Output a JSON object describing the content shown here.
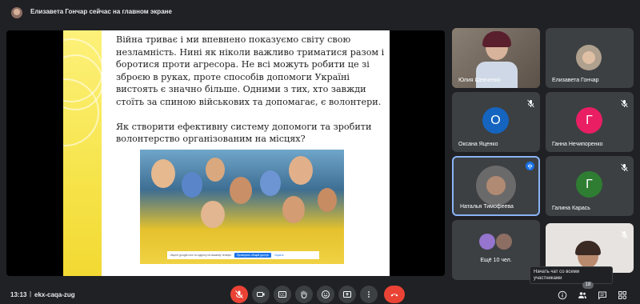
{
  "topbar": {
    "presenter_text": "Елизавета Гончар сейчас на главном экране"
  },
  "slide": {
    "paragraph1": "Війна триває і ми впевнено показуємо світу свою незламність. Нині як ніколи важливо триматися разом і боротися проти агресора. Не всі можуть робити це зі зброєю в руках, проте способів допомоги Україні вистоять є значно більше. Одними з тих, хто завжди стоїть за спиною військових та допомагає, є волонтери.",
    "paragraph2": "Як створити ефективну систему допомоги та зробити волонтерство організованим на місцях?",
    "photo_searchbar": {
      "text": "Ищете google.com по адресу на вашему телефону",
      "button": "Проверить общий доступ",
      "link": "Скрыть"
    }
  },
  "participants": [
    {
      "name": "Юлия Шевченко",
      "type": "video"
    },
    {
      "name": "Елизавета Гончар",
      "type": "photo"
    },
    {
      "name": "Оксана Яценко",
      "initial": "О",
      "color": "#1565c0",
      "muted": true
    },
    {
      "name": "Ганна Нечипоренко",
      "initial": "Г",
      "color": "#e91e63",
      "muted": true
    },
    {
      "name": "Наталья Тимофеева",
      "type": "photo",
      "speaking": true
    },
    {
      "name": "Галина Карась",
      "initial": "Г",
      "color": "#2e7d32",
      "muted": true
    },
    {
      "name": "Ещё 10 чел.",
      "type": "group"
    },
    {
      "name": "",
      "type": "video-self",
      "muted": true
    }
  ],
  "bottombar": {
    "time": "13:13",
    "separator": "|",
    "meeting_code": "ekx-caqa-zug",
    "participant_count": "18",
    "chat_tooltip": "Начать чат со всеми участниками"
  },
  "colors": {
    "background": "#202124",
    "tile": "#3c4043",
    "danger": "#ea4335",
    "accent": "#8ab4f8"
  },
  "icons": [
    "mic-off-icon",
    "camera-icon",
    "captions-icon",
    "raise-hand-icon",
    "emoji-icon",
    "present-icon",
    "more-icon",
    "end-call-icon",
    "info-icon",
    "people-icon",
    "chat-icon",
    "activities-icon"
  ]
}
